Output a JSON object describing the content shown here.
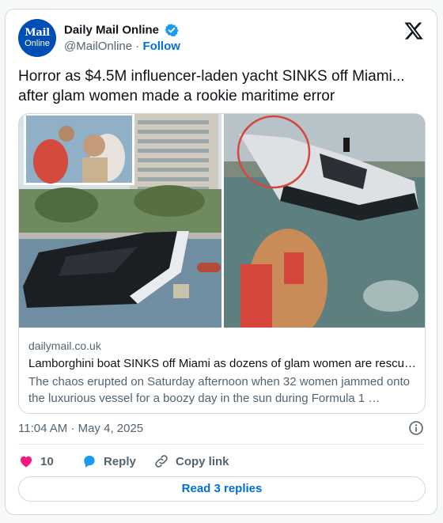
{
  "account": {
    "display_name": "Daily Mail Online",
    "handle": "@MailOnline",
    "separator": "·",
    "follow_label": "Follow",
    "avatar_line1": "Mail",
    "avatar_line2": "Online"
  },
  "tweet": {
    "text": "Horror as $4.5M influencer-laden yacht SINKS off Miami... after glam women made a rookie maritime error"
  },
  "link_card": {
    "domain": "dailymail.co.uk",
    "title": "Lamborghini boat SINKS off Miami as dozens of glam women are rescu…",
    "description": "The chaos erupted on Saturday afternoon when 32 women jammed onto the luxurious vessel for a boozy day in the sun during Formula 1 …"
  },
  "meta": {
    "timestamp": "11:04 AM · May 4, 2025"
  },
  "actions": {
    "like_count": "10",
    "reply_label": "Reply",
    "copy_label": "Copy link"
  },
  "read_replies_label": "Read 3 replies",
  "colors": {
    "accent": "#006fd6",
    "like": "#f91880",
    "reply": "#1d9bf0",
    "avatar_bg": "#004db3"
  },
  "icons": [
    "verified-badge-icon",
    "x-logo-icon",
    "info-icon",
    "heart-icon",
    "reply-bubble-icon",
    "link-icon"
  ]
}
